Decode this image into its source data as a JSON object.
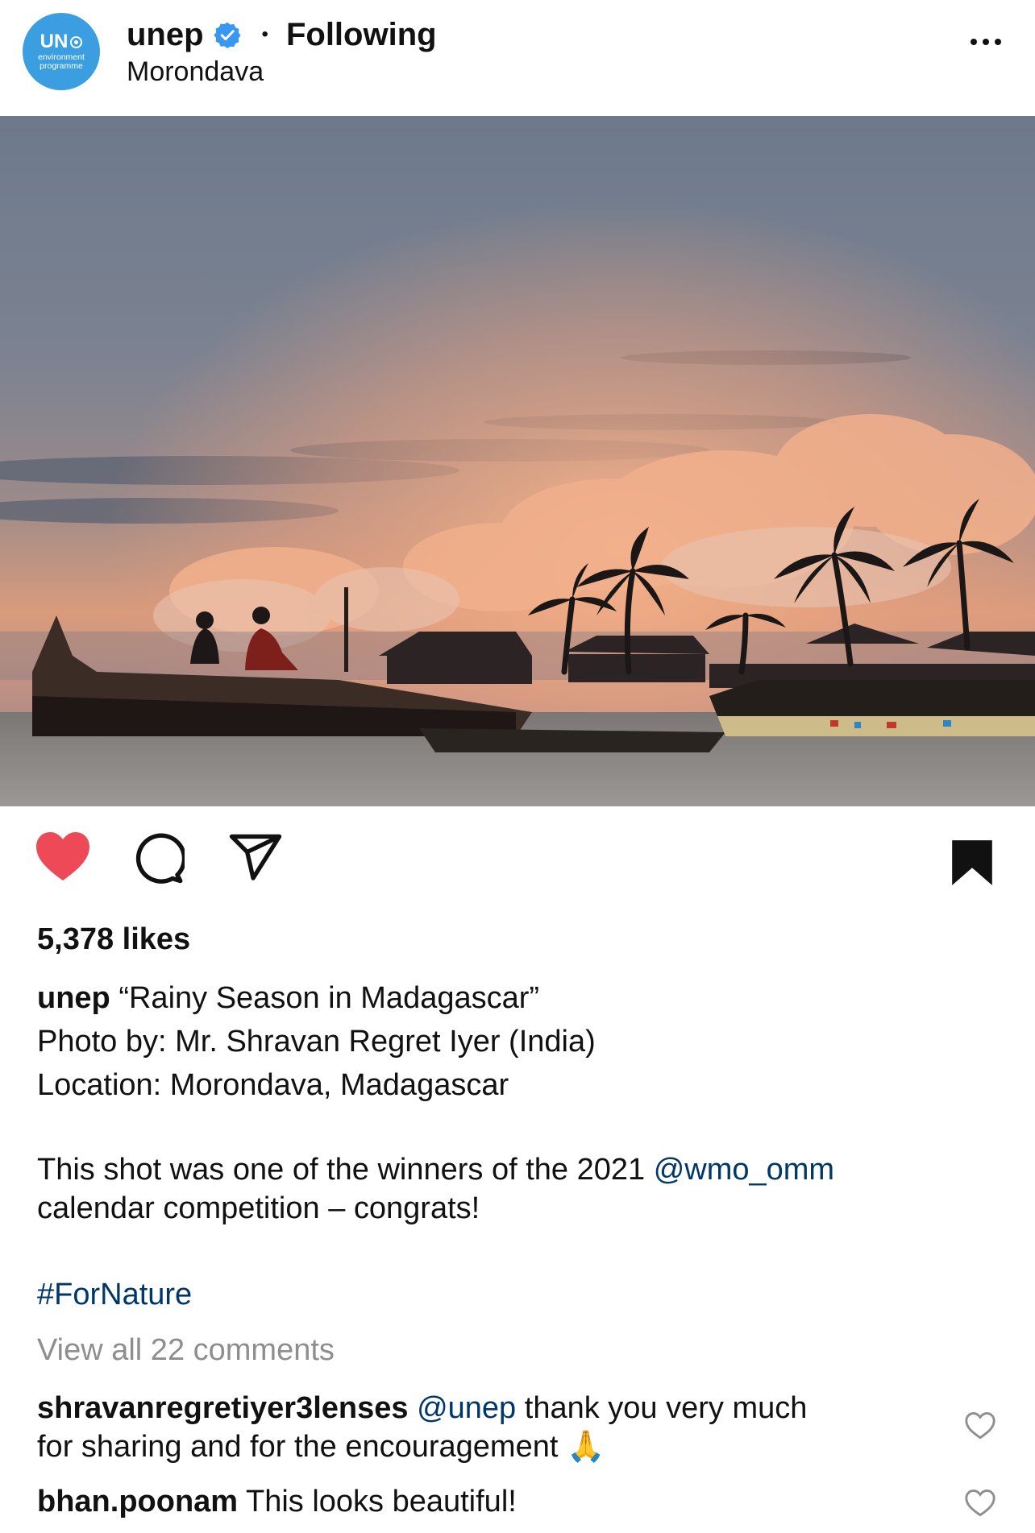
{
  "header": {
    "avatar": {
      "line1": "UN",
      "line2": "environment",
      "line3": "programme",
      "color": "#3b9ee0"
    },
    "username": "unep",
    "verified_icon": "verified-badge-icon",
    "separator": "•",
    "follow_label": "Following",
    "location": "Morondava",
    "more_icon": "more-options-icon"
  },
  "post": {
    "image_alt": "Rainy Season in Madagascar – sunset over beach with boats and palm trees",
    "liked": true,
    "like_color": "#ed4956",
    "saved": true
  },
  "likes": "5,378 likes",
  "caption": {
    "username": "unep",
    "line1": " “Rainy Season in Madagascar”",
    "line2": "Photo by: Mr. Shravan Regret Iyer (India)",
    "line3": "Location: Morondava, Madagascar",
    "para2_before": "This shot was one of the winners of the 2021 ",
    "para2_mention": "@wmo_omm",
    "para2_after": "calendar competition – congrats!",
    "hashtag": "#ForNature"
  },
  "view_all": "View all 22 comments",
  "comments": [
    {
      "username": "shravanregretiyer3lenses",
      "mention": "@unep",
      "text_a": " thank you very much",
      "text_b": "for sharing and for the encouragement 🙏"
    },
    {
      "username": "bhan.poonam",
      "text": " This looks beautiful!"
    }
  ],
  "colors": {
    "link": "#00376b",
    "muted": "#8e8e8e"
  }
}
